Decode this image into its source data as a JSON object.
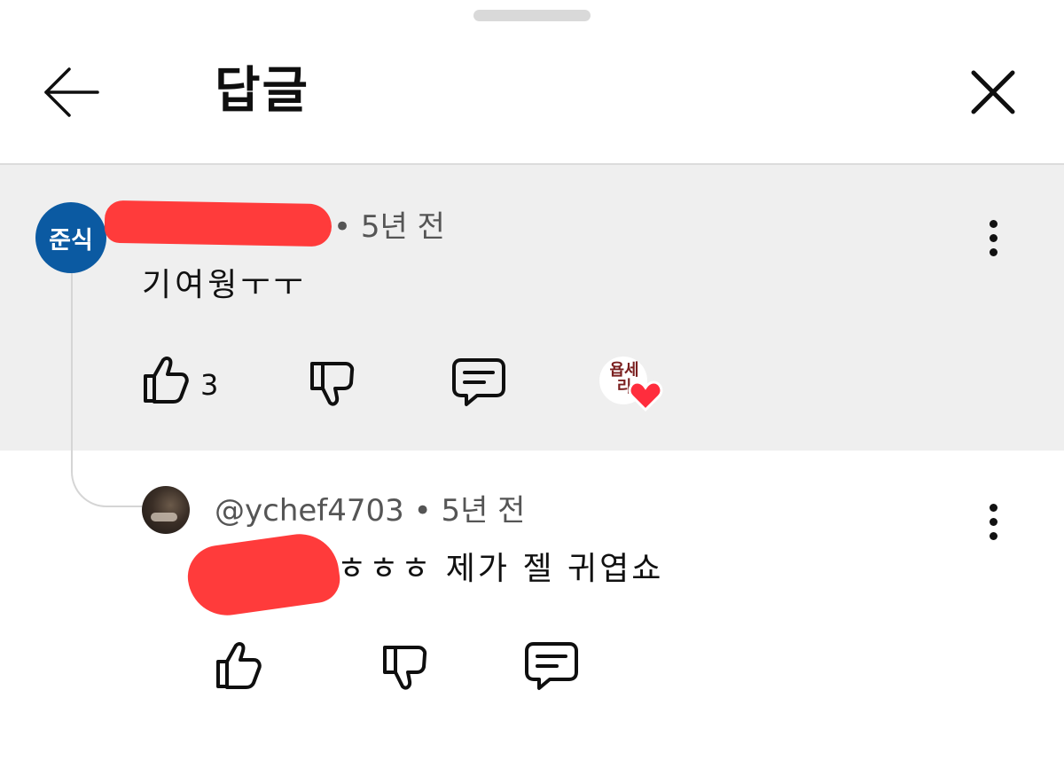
{
  "drag_handle": {
    "role": "sheet-handle"
  },
  "header": {
    "title": "답글",
    "back_icon": "arrow-left-icon",
    "close_icon": "close-icon"
  },
  "main_comment": {
    "avatar_text": "준식",
    "avatar_color": "#0b5aa2",
    "meta": "• 5년 전",
    "text": "기여웡ㅜㅜ",
    "like_count": "3",
    "creator_heart_logo": "욥세리",
    "heart_color": "#ff2d3d"
  },
  "reply": {
    "meta": "@ychef4703 • 5년 전",
    "text": "ㅎㅎㅎ 제가 젤 귀엽쇼"
  },
  "colors": {
    "highlight_bg": "#efefef",
    "redaction": "#ff3b3b"
  }
}
